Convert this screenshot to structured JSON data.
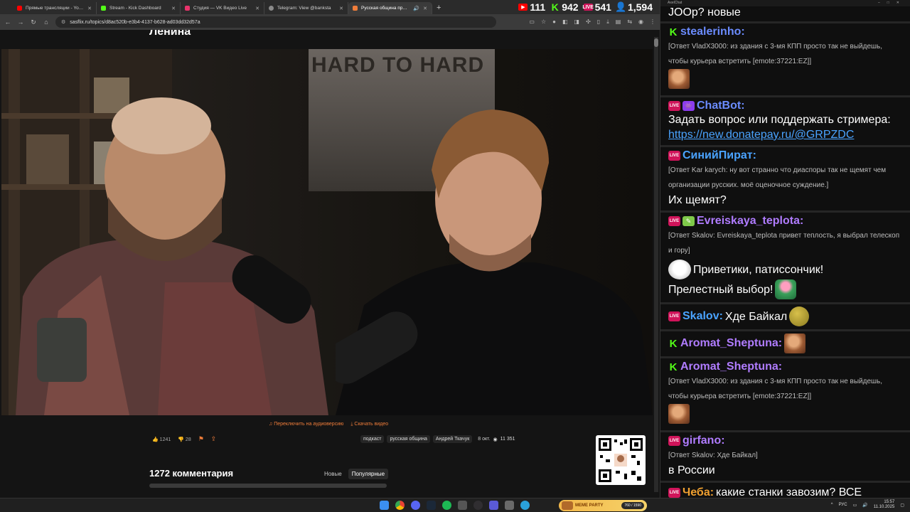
{
  "browser": {
    "tabs": [
      {
        "title": "Прямые трансляции - YouTube",
        "color": "#ff0000",
        "active": false
      },
      {
        "title": "Stream - Kick Dashboard",
        "color": "#53fc18",
        "active": false
      },
      {
        "title": "Студия — VK Видео Live",
        "color": "#e8336b",
        "active": false
      },
      {
        "title": "Telegram: View @banksta",
        "color": "#8a8a8a",
        "active": false
      },
      {
        "title": "Русская община про мигр...",
        "color": "#f07d3a",
        "active": true
      }
    ],
    "url": "sasflix.ru/topics/d8ac520b-e3b4-4137-b628-ad03dd32d57a"
  },
  "stream_stats": {
    "youtube": "111",
    "kick": "942",
    "vk": "541",
    "total": "1,594"
  },
  "page": {
    "heading": "Ленина",
    "poster_text": "HARD TO HARD",
    "actions": {
      "audio": "Переключить на аудиоверсию",
      "download": "Скачать видео"
    },
    "likes": "1241",
    "dislikes": "28",
    "tags": [
      "подкаст",
      "русская община",
      "Андрей Ткачук"
    ],
    "date": "8 окт.",
    "views": "11 351",
    "comments_title": "1272 комментария",
    "sort": {
      "new": "Новые",
      "popular": "Популярные"
    }
  },
  "chat": {
    "window_title": "AxelChat",
    "top_text": "JOOp? новые",
    "messages": [
      {
        "name": "stealerinho:",
        "name_color": "#6b8cff",
        "badge": "kick",
        "reply": "[Ответ VladX3000: из здания с 3-мя КПП просто так не выйдешь, чтобы курьера встретить [emote:37221:EZ]]",
        "emote": "face"
      },
      {
        "name": "ChatBot:",
        "name_color": "#6b8cff",
        "badge": "live-bot",
        "text": "Задать вопрос или поддержать стримера:",
        "link": "https://new.donatepay.ru/@GRPZDC"
      },
      {
        "name": "СинийПират:",
        "name_color": "#4aa3ff",
        "badge": "live",
        "reply": "[Ответ Kar karych: ну вот странно что диаспоры так не щемят чем организации русских. моё оценочное суждение.]",
        "text": "Их щемят?"
      },
      {
        "name": "Evreiskaya_teplota:",
        "name_color": "#b07cff",
        "badge": "live-pen",
        "reply": "[Ответ Skalov: Evreiskaya_teplota привет теплость, я выбрал телескоп и гору]",
        "text1": "Приветики, патиссончик!",
        "text2": "Прелестный выбор!"
      },
      {
        "name": "Skalov:",
        "name_color": "#4aa3ff",
        "badge": "live",
        "text": "Хде Байкал"
      },
      {
        "name": "Aromat_Sheptuna:",
        "name_color": "#b07cff",
        "badge": "kick",
        "emote": "face"
      },
      {
        "name": "Aromat_Sheptuna:",
        "name_color": "#b07cff",
        "badge": "kick",
        "reply": "[Ответ VladX3000: из здания с 3-мя КПП просто так не выйдешь, чтобы курьера встретить [emote:37221:EZ]]",
        "emote": "face"
      },
      {
        "name": "girfano:",
        "name_color": "#b07cff",
        "badge": "live",
        "reply": "[Ответ Skalov: Хде Байкал]",
        "text": "в России"
      },
      {
        "name": "Чеба:",
        "name_color": "#f0a030",
        "badge": "live",
        "text": "какие станки завозим? ВСЕ"
      }
    ]
  },
  "taskbar": {
    "party_label": "MEME PARTY",
    "party_count": "760 / 1590",
    "lang": "РУС",
    "time": "15:57",
    "date": "11.10.2025"
  }
}
